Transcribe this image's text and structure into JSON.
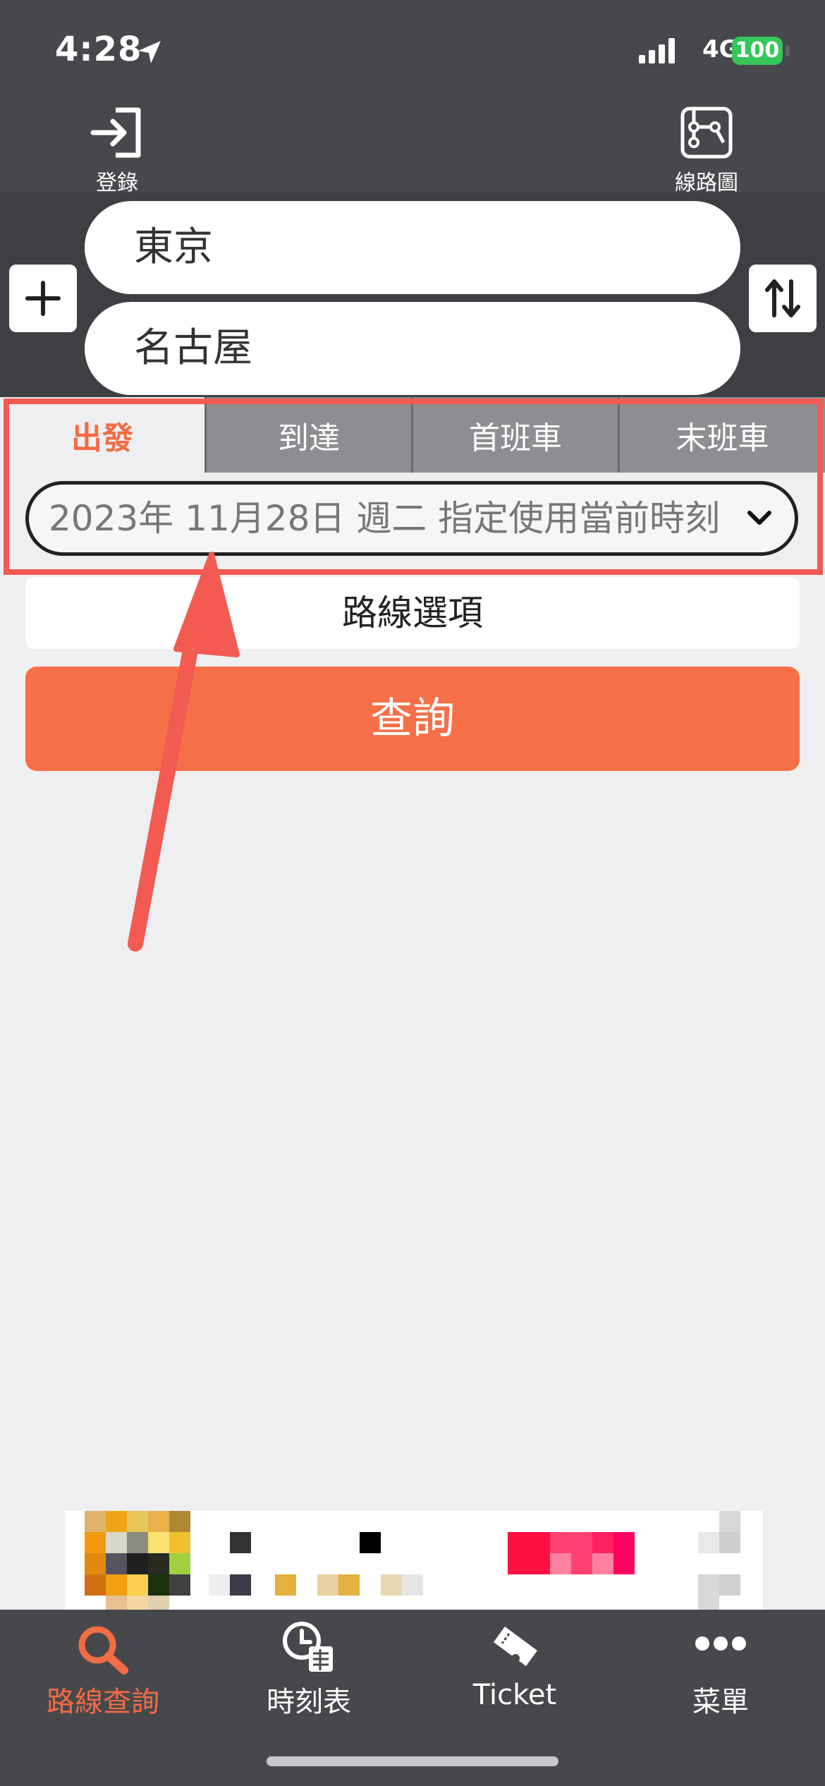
{
  "status_bar": {
    "time": "4:28",
    "network": "4G",
    "battery": "100"
  },
  "header": {
    "login_label": "登錄",
    "route_map_label": "線路圖"
  },
  "search": {
    "from": "東京",
    "to": "名古屋"
  },
  "tabs": [
    {
      "label": "出發",
      "active": true
    },
    {
      "label": "到達",
      "active": false
    },
    {
      "label": "首班車",
      "active": false
    },
    {
      "label": "末班車",
      "active": false
    }
  ],
  "datetime": {
    "value": "2023年 11月28日 週二 指定使用當前時刻"
  },
  "route_options_label": "路線選項",
  "query_label": "查詢",
  "bottom_nav": [
    {
      "label": "路線查詢",
      "icon": "search-icon",
      "active": true
    },
    {
      "label": "時刻表",
      "icon": "timetable-icon",
      "active": false
    },
    {
      "label": "Ticket",
      "icon": "ticket-icon",
      "active": false
    },
    {
      "label": "菜單",
      "icon": "more-icon",
      "active": false
    }
  ],
  "colors": {
    "accent": "#f26c45",
    "button": "#f57048",
    "highlight": "#f25a52",
    "header": "#47484c"
  }
}
